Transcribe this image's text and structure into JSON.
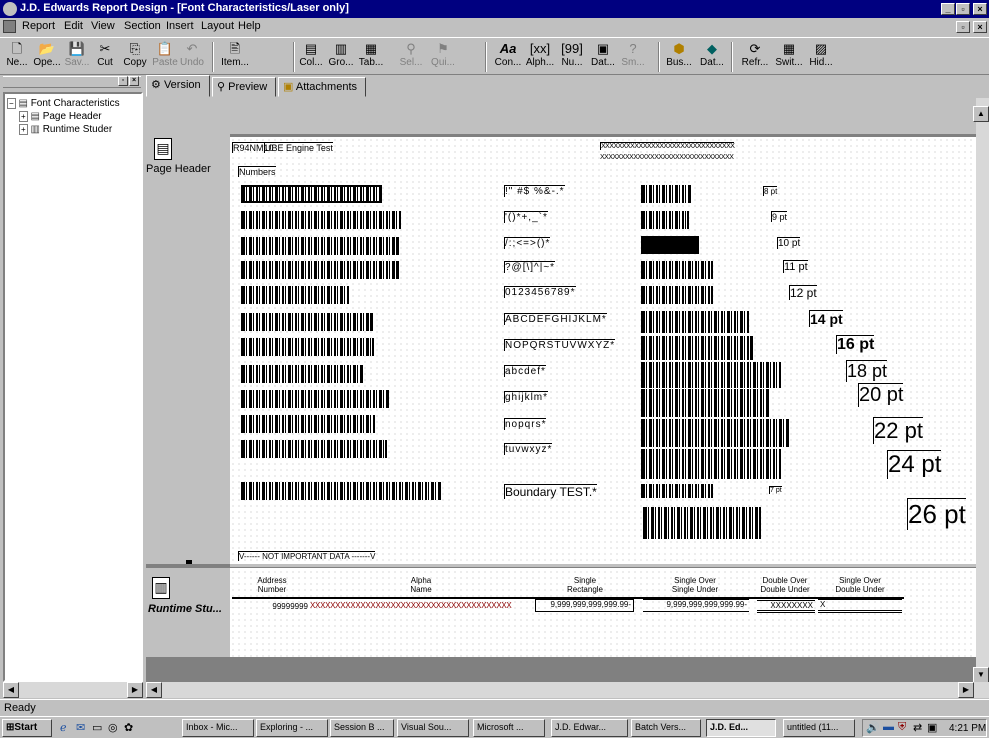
{
  "window": {
    "title": "J.D. Edwards Report Design - [Font Characteristics/Laser only]"
  },
  "menu": [
    "Report",
    "Edit",
    "View",
    "Section",
    "Insert",
    "Layout",
    "Help"
  ],
  "toolbar": [
    {
      "label": "Ne...",
      "icon": "new-icon",
      "enabled": true
    },
    {
      "label": "Ope...",
      "icon": "open-icon",
      "enabled": true
    },
    {
      "label": "Sav...",
      "icon": "save-icon",
      "enabled": false
    },
    {
      "label": "Cut",
      "icon": "cut-icon",
      "enabled": true
    },
    {
      "label": "Copy",
      "icon": "copy-icon",
      "enabled": true
    },
    {
      "label": "Paste",
      "icon": "paste-icon",
      "enabled": false
    },
    {
      "label": "Undo",
      "icon": "undo-icon",
      "enabled": false
    },
    {
      "label": "Item...",
      "icon": "item-icon",
      "enabled": true
    },
    {
      "label": "Col...",
      "icon": "columnar-icon",
      "enabled": true
    },
    {
      "label": "Gro...",
      "icon": "group-icon",
      "enabled": true
    },
    {
      "label": "Tab...",
      "icon": "tabular-icon",
      "enabled": true
    },
    {
      "label": "Sel...",
      "icon": "select-icon",
      "enabled": false
    },
    {
      "label": "Qui...",
      "icon": "quit-icon",
      "enabled": false
    },
    {
      "label": "Con...",
      "icon": "constant-icon",
      "enabled": true
    },
    {
      "label": "Alph...",
      "icon": "alpha-icon",
      "enabled": true
    },
    {
      "label": "Nu...",
      "icon": "numeric-icon",
      "enabled": true
    },
    {
      "label": "Dat...",
      "icon": "date-icon",
      "enabled": true
    },
    {
      "label": "Sm...",
      "icon": "smart-icon",
      "enabled": false
    },
    {
      "label": "Bus...",
      "icon": "business-view-icon",
      "enabled": true
    },
    {
      "label": "Dat...",
      "icon": "data-selection-icon",
      "enabled": true
    },
    {
      "label": "Refr...",
      "icon": "refresh-icon",
      "enabled": true
    },
    {
      "label": "Swit...",
      "icon": "switch-icon",
      "enabled": true
    },
    {
      "label": "Hid...",
      "icon": "hide-icon",
      "enabled": true
    }
  ],
  "tree": {
    "root": "Font Characteristics",
    "children": [
      "Page Header",
      "Runtime Studer"
    ]
  },
  "tabs": [
    "Version",
    "Preview",
    "Attachments"
  ],
  "sections": {
    "page_header": "Page Header",
    "runtime": "Runtime Stu..."
  },
  "header": {
    "report_id": "R94NM10",
    "report_title": "UBE Engine Test",
    "x_line_1": "XXXXXXXXXXXXXXXXXXXXXXXXXXXXXXXX",
    "x_line_2": "XXXXXXXXXXXXXXXXXXXXXXXXXXXXXXXX",
    "numbers_label": "Numbers"
  },
  "char_rows": [
    "!\" #$ %&-.*",
    "'()*+,_`*",
    "/:;<=>()*",
    "?@[\\]^|~*",
    "0123456789*",
    "ABCDEFGHIJKLM*",
    "NOPQRSTUVWXYZ*",
    "abcdef*",
    "ghijklm*",
    "nopqrs*",
    "tuvwxyz*"
  ],
  "sizes": [
    "8 pt",
    "9 pt",
    "10 pt",
    "11 pt",
    "12 pt",
    "14 pt",
    "16 pt",
    "18 pt",
    "20 pt",
    "22 pt",
    "24 pt",
    "26 pt"
  ],
  "boundary": {
    "text": "Boundary TEST.*",
    "size": "7 pt"
  },
  "footer_note": "V------ NOT IMPORTANT DATA -------V",
  "runtime_columns": [
    {
      "h1": "Address",
      "h2": "Number"
    },
    {
      "h1": "Alpha",
      "h2": "Name"
    },
    {
      "h1": "Single",
      "h2": "Rectangle"
    },
    {
      "h1": "Single Over",
      "h2": "Single Under"
    },
    {
      "h1": "Double Over",
      "h2": "Double Under"
    },
    {
      "h1": "Single Over",
      "h2": "Double Under"
    }
  ],
  "runtime_values": {
    "address": "99999999",
    "alpha": "XXXXXXXXXXXXXXXXXXXXXXXXXXXXXXXXXXXXXXXX",
    "single": "9,999,999,999,999.99-",
    "single_over": "9,999,999,999,999.99-",
    "double_over": "XXXXXXXX",
    "single_double": "X"
  },
  "status": "Ready",
  "taskbar": {
    "start": "Start",
    "tasks": [
      "Inbox - Mic...",
      "Exploring - ...",
      "Session B ...",
      "Visual Sou...",
      "Microsoft ...",
      "J.D. Edwar...",
      "Batch Vers...",
      "J.D. Ed...",
      "untitled (11..."
    ],
    "clock": "4:21 PM"
  }
}
